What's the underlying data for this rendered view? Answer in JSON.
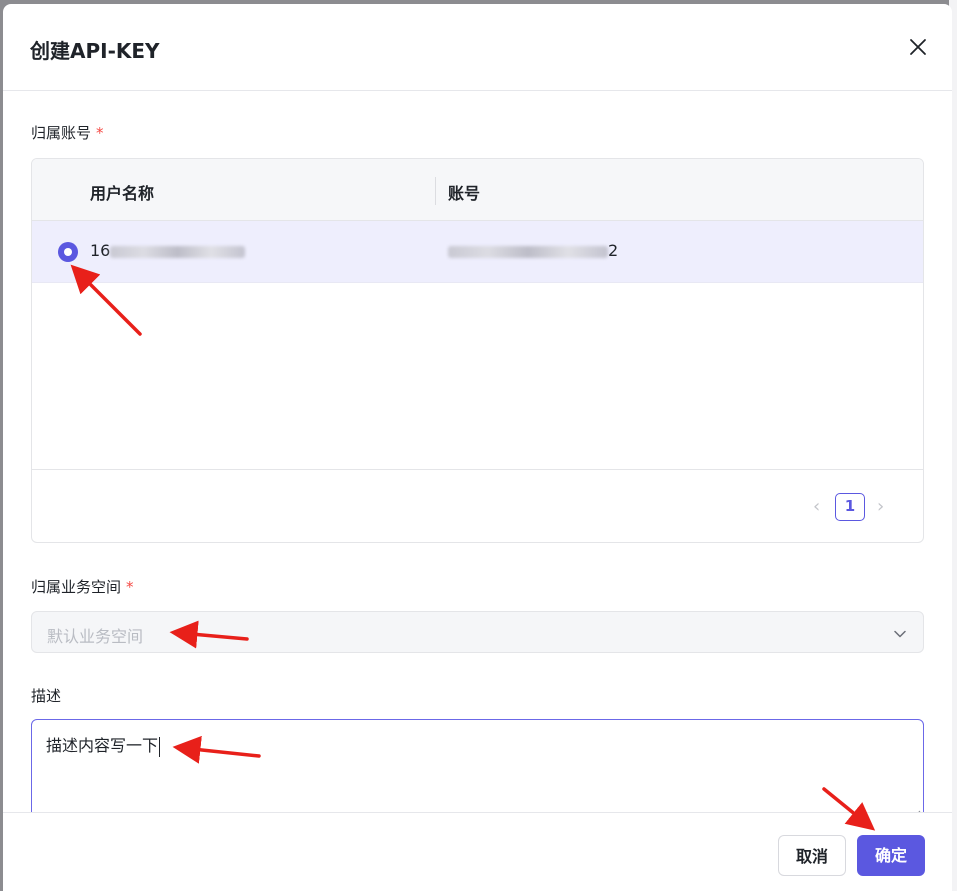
{
  "dialog": {
    "title": "创建API-KEY"
  },
  "account_field": {
    "label": "归属账号",
    "required_mark": "*",
    "columns": [
      "用户名称",
      "账号"
    ],
    "rows": [
      {
        "username": "16",
        "account": "2",
        "selected": true
      }
    ],
    "pagination": {
      "current_page": "1",
      "prev_icon": "chevron-left-icon",
      "next_icon": "chevron-right-icon"
    }
  },
  "workspace_field": {
    "label": "归属业务空间",
    "required_mark": "*",
    "placeholder": "默认业务空间"
  },
  "description_field": {
    "label": "描述",
    "value": "描述内容写一下"
  },
  "footer": {
    "cancel_label": "取消",
    "confirm_label": "确定"
  },
  "colors": {
    "accent": "#5b58e0",
    "annotation_arrow": "#e8201a",
    "selected_row": "#eeeefd",
    "required": "#f54a45"
  }
}
